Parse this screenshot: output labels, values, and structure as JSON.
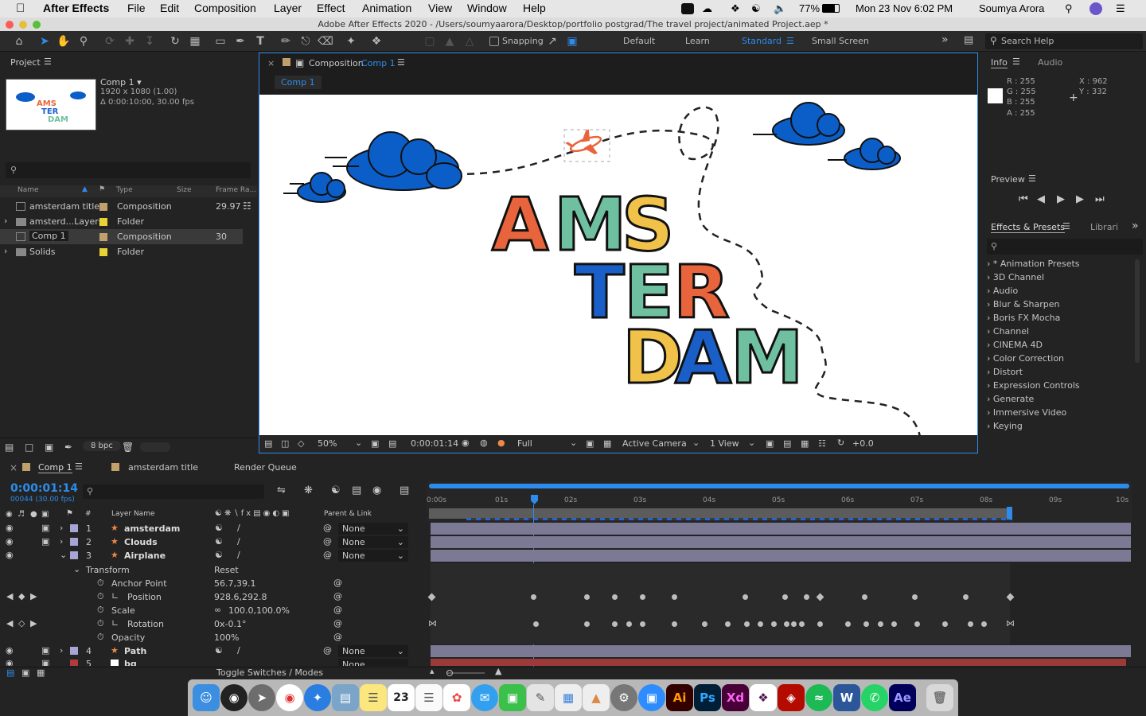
{
  "menubar": {
    "app": "After Effects",
    "items": [
      "File",
      "Edit",
      "Composition",
      "Layer",
      "Effect",
      "Animation",
      "View",
      "Window",
      "Help"
    ],
    "battery": "77%",
    "datetime": "Mon 23 Nov  6:02 PM",
    "user": "Soumya Arora"
  },
  "window_title": "Adobe After Effects 2020 - /Users/soumyaarora/Desktop/portfolio postgrad/The travel project/animated Project.aep *",
  "toolbar": {
    "snapping": "Snapping",
    "workspaces": [
      "Default",
      "Learn",
      "Standard",
      "Small Screen"
    ],
    "active_workspace": "Standard",
    "search_placeholder": "Search Help"
  },
  "project": {
    "tab": "Project",
    "comp_name": "Comp 1 ▾",
    "comp_res": "1920 x 1080 (1.00)",
    "comp_dur": "Δ 0:00:10:00, 30.00 fps",
    "columns": [
      "Name",
      "Type",
      "Size",
      "Frame Ra..."
    ],
    "rows": [
      {
        "name": "amsterdam title",
        "type": "Composition",
        "size": "",
        "fps": "29.97",
        "color": "#c2a06c"
      },
      {
        "name": "amsterd...Layers",
        "type": "Folder",
        "size": "",
        "fps": "",
        "color": "#e8d234"
      },
      {
        "name": "Comp 1",
        "type": "Composition",
        "size": "",
        "fps": "30",
        "color": "#c2a06c"
      },
      {
        "name": "Solids",
        "type": "Folder",
        "size": "",
        "fps": "",
        "color": "#e8d234"
      }
    ],
    "bpc": "8 bpc"
  },
  "composition": {
    "tab_label": "Composition",
    "tab_name": "Comp 1",
    "crumb": "Comp 1",
    "title_lines": [
      [
        "A",
        "M",
        "S"
      ],
      [
        "T",
        "E",
        "R"
      ],
      [
        "D",
        "A",
        "M"
      ]
    ],
    "zoom": "50%",
    "timecode": "0:00:01:14",
    "resolution": "Full",
    "camera": "Active Camera",
    "views": "1 View",
    "exposure": "+0.0"
  },
  "info": {
    "tab": "Info",
    "tab2": "Audio",
    "r": "R :  255",
    "g": "G :  255",
    "b": "B :  255",
    "a": "A :  255",
    "x": "X : 962",
    "y": "Y : 332"
  },
  "preview": {
    "tab": "Preview"
  },
  "effects": {
    "tab": "Effects & Presets",
    "tab2": "Librari",
    "items": [
      "* Animation Presets",
      "3D Channel",
      "Audio",
      "Blur & Sharpen",
      "Boris FX Mocha",
      "Channel",
      "CINEMA 4D",
      "Color Correction",
      "Distort",
      "Expression Controls",
      "Generate",
      "Immersive Video",
      "Keying"
    ]
  },
  "timeline": {
    "tabs": [
      "Comp 1",
      "amsterdam title",
      "Render Queue"
    ],
    "timecode": "0:00:01:14",
    "frames": "00044 (30.00 fps)",
    "col_layer": "Layer Name",
    "col_parent": "Parent & Link",
    "ruler": [
      "0:00s",
      "01s",
      "02s",
      "03s",
      "04s",
      "05s",
      "06s",
      "07s",
      "08s",
      "09s",
      "10s"
    ],
    "layers": [
      {
        "num": "1",
        "name": "amsterdam",
        "parent": "None",
        "color": "#a7a5d6"
      },
      {
        "num": "2",
        "name": "Clouds",
        "parent": "None",
        "color": "#a7a5d6"
      },
      {
        "num": "3",
        "name": "Airplane",
        "parent": "None",
        "color": "#a7a5d6"
      }
    ],
    "transform_label": "Transform",
    "reset": "Reset",
    "props": [
      {
        "name": "Anchor Point",
        "value": "56.7,39.1"
      },
      {
        "name": "Position",
        "value": "928.6,292.8"
      },
      {
        "name": "Scale",
        "value": "100.0,100.0%"
      },
      {
        "name": "Rotation",
        "value": "0x-0.1°"
      },
      {
        "name": "Opacity",
        "value": "100%"
      }
    ],
    "layer4": {
      "num": "4",
      "name": "Path",
      "parent": "None"
    },
    "layer5": {
      "num": "5",
      "name": "bg",
      "parent": "None"
    },
    "toggle": "Toggle Switches / Modes"
  },
  "colors": {
    "accent": "#2d8ceb",
    "cloud": "#0b5ec8",
    "orange": "#e8643c",
    "green": "#6fc0a0",
    "yellow": "#f0c24a",
    "blue": "#1a5fc8"
  },
  "dock": {
    "calendar_day": "23",
    "ai": "Ai",
    "ps": "Ps",
    "xd": "Xd",
    "ae": "Ae",
    "w": "W"
  }
}
